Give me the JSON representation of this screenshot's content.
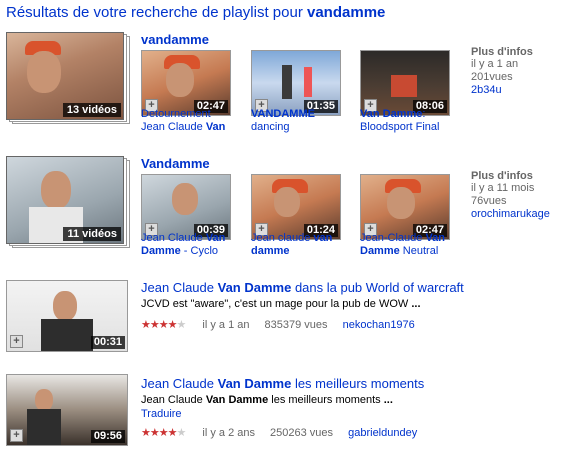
{
  "header": {
    "prefix": "Résultats de votre recherche de playlist pour",
    "query": "vandamme"
  },
  "playlists": [
    {
      "title": "vandamme",
      "video_count": "13 vidéos",
      "videos": [
        {
          "duration": "02:47",
          "cap1": "Detournement",
          "cap2a": "Jean Claude ",
          "cap2b": "Van"
        },
        {
          "duration": "01:35",
          "cap1a": "VANDAMME",
          "cap2": "dancing"
        },
        {
          "duration": "08:06",
          "cap1a": "Van Damme",
          "cap1b": ":",
          "cap2": "Bloodsport Final"
        }
      ],
      "info": {
        "head": "Plus d'infos",
        "ago": "il y a 1 an",
        "views": "201vues",
        "user": "2b34u"
      }
    },
    {
      "title": "Vandamme",
      "video_count": "11 vidéos",
      "videos": [
        {
          "duration": "00:39",
          "cap1a": "Jean Claude ",
          "cap1b": "Van",
          "cap2a": "Damme",
          "cap2b": " - Cyclo"
        },
        {
          "duration": "01:24",
          "cap1a": "Jean claude ",
          "cap1b": "van",
          "cap2a": "damme",
          "cap2b": ""
        },
        {
          "duration": "02:47",
          "cap1a": "Jean-Claude ",
          "cap1b": "Van",
          "cap2a": "Damme",
          "cap2b": " Neutral"
        }
      ],
      "info": {
        "head": "Plus d'infos",
        "ago": "il y a 11 mois",
        "views": "76vues",
        "user": "orochimarukage"
      }
    }
  ],
  "videos": [
    {
      "title_a": "Jean Claude ",
      "title_b": "Van Damme",
      "title_c": " dans la pub World of warcraft",
      "desc_a": "JCVD est \"aware\", c'est un mage pour la pub de WOW ",
      "desc_b": "...",
      "duration": "00:31",
      "rating_stars": "★★★★",
      "rating_half": "★",
      "ago": "il y a 1 an",
      "views": "835379 vues",
      "user": "nekochan1976"
    },
    {
      "title_a": "Jean Claude ",
      "title_b": "Van Damme",
      "title_c": " les meilleurs moments",
      "desc_a": "Jean Claude ",
      "desc_b": "Van Damme",
      "desc_c": " les meilleurs moments ",
      "desc_d": "...",
      "translate": "Traduire",
      "duration": "09:56",
      "rating_stars": "★★★★",
      "rating_half": "★",
      "ago": "il y a 2 ans",
      "views": "250263 vues",
      "user": "gabrieldundey"
    }
  ],
  "icons": {
    "add": "+"
  },
  "colors": {
    "link": "#0033cc",
    "star": "#cc3333",
    "meta": "#666666"
  }
}
